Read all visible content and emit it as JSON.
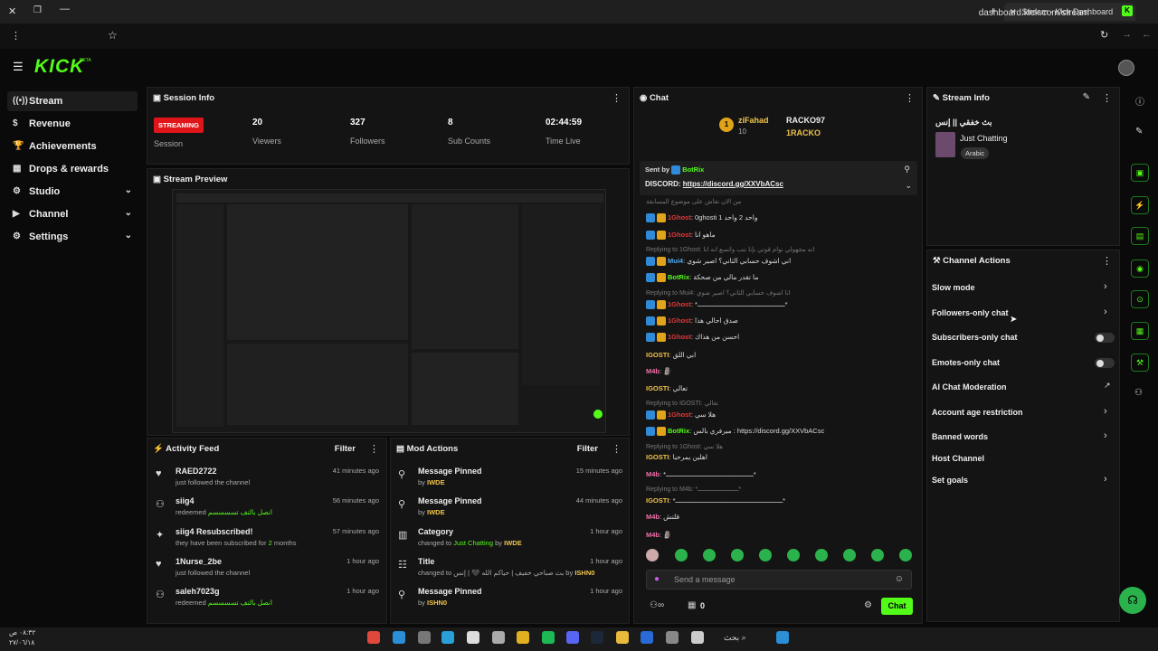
{
  "browser": {
    "tab_title": "Stream - Kick Dashboard",
    "url": "dashboard.kick.com/stream"
  },
  "brand": {
    "logo": "KICK",
    "beta": "BETA"
  },
  "sidebar": {
    "items": [
      {
        "label": "Stream",
        "icon": "stream-icon"
      },
      {
        "label": "Revenue",
        "icon": "dollar-icon"
      },
      {
        "label": "Achievements",
        "icon": "trophy-icon"
      },
      {
        "label": "Drops & rewards",
        "icon": "gift-icon"
      },
      {
        "label": "Studio",
        "icon": "gear-icon"
      },
      {
        "label": "Channel",
        "icon": "video-icon"
      },
      {
        "label": "Settings",
        "icon": "gear-icon"
      }
    ]
  },
  "session": {
    "title": "Session Info",
    "status": "STREAMING",
    "status_label": "Session",
    "viewers": "20",
    "viewers_label": "Viewers",
    "followers": "327",
    "followers_label": "Followers",
    "subs": "8",
    "subs_label": "Sub Counts",
    "time": "02:44:59",
    "time_label": "Time Live"
  },
  "preview": {
    "title": "Stream Preview"
  },
  "activity": {
    "title": "Activity Feed",
    "filter": "Filter",
    "items": [
      {
        "title": "RAED2722",
        "sub": "just followed the channel",
        "time": "41 minutes ago",
        "icon": "heart-icon"
      },
      {
        "title": "siig4",
        "sub": "redeemed",
        "sub2": "انصل بالتف تسسسسم",
        "time": "56 minutes ago",
        "icon": "redeem-icon"
      },
      {
        "title": "siig4 Resubscribed!",
        "sub": "they have been subscribed for",
        "sub2": "2",
        "sub3": "months",
        "time": "57 minutes ago",
        "icon": "star-icon"
      },
      {
        "title": "1Nurse_2be",
        "sub": "just followed the channel",
        "time": "1 hour ago",
        "icon": "heart-icon"
      },
      {
        "title": "saleh7023g",
        "sub": "redeemed",
        "sub2": "انصل بالتف تسسسسم",
        "time": "1 hour ago",
        "icon": "redeem-icon"
      }
    ]
  },
  "mod": {
    "title": "Mod Actions",
    "filter": "Filter",
    "items": [
      {
        "title": "Message Pinned",
        "sub": "by",
        "user": "IWDE",
        "time": "15 minutes ago",
        "icon": "pin-icon"
      },
      {
        "title": "Message Pinned",
        "sub": "by",
        "user": "IWDE",
        "time": "44 minutes ago",
        "icon": "pin-icon"
      },
      {
        "title": "Category",
        "sub": "changed to",
        "value": "Just Chatting",
        "sub2": "by",
        "user": "IWDE",
        "time": "1 hour ago",
        "icon": "category-icon"
      },
      {
        "title": "Title",
        "sub": "changed to",
        "value": "بث صباحي خفيف | حياكم الله 🖤 | إنس",
        "sub2": "by",
        "user": "ISHN0",
        "time": "1 hour ago",
        "icon": "title-icon"
      },
      {
        "title": "Message Pinned",
        "sub": "by",
        "user": "ISHN0",
        "time": "1 hour ago",
        "icon": "pin-icon"
      }
    ]
  },
  "chat": {
    "title": "Chat",
    "top1": {
      "name": "ziFahad",
      "count": "10",
      "rank": "1"
    },
    "top2": {
      "name": "RACKO97"
    },
    "top3": {
      "name": "1RACKO"
    },
    "pinned": {
      "sent_by": "Sent by",
      "user": "BotRix",
      "text_prefix": "DISCORD:",
      "link": "https://discord.gg/XXVbACsc"
    },
    "lines": [
      {
        "kind": "reply",
        "text": "من الان نقاش على موضوع المسابقة"
      },
      {
        "kind": "msg",
        "user": "1Ghost",
        "text": "0ghosti 1 واحد 2 واحد",
        "ucls": "u-red"
      },
      {
        "kind": "msg",
        "user": "1Ghost",
        "text": "ماهو انا",
        "ucls": "u-red"
      },
      {
        "kind": "reply",
        "text": "Replying to 1Ghost: انه مجهولي نوام قوتي بإنا نتب واتسع انه انا"
      },
      {
        "kind": "msg",
        "user": "Mui4",
        "text": "اني اشوف حسابي الثاني؟ اصير شوي",
        "ucls": "u-blue"
      },
      {
        "kind": "msg",
        "user": "BotRix",
        "text": "ما تقدر مالي من صحكة",
        "ucls": "u-green"
      },
      {
        "kind": "reply",
        "text": "Replying to Mui4: انا اشوف حسابي الثاني؟ اصير شوي"
      },
      {
        "kind": "msg",
        "user": "1Ghost",
        "text": "*ــــــــــــــــــــــــــــــــــــــــــــ*",
        "ucls": "u-red"
      },
      {
        "kind": "msg",
        "user": "1Ghost",
        "text": "صدق احالي هذا",
        "ucls": "u-red"
      },
      {
        "kind": "msg",
        "user": "1Ghost",
        "text": "احسن من هذاك",
        "ucls": "u-red"
      },
      {
        "kind": "msg",
        "user": "IGOSTI",
        "text": "ابي اللق",
        "ucls": "u-gold"
      },
      {
        "kind": "msg",
        "user": "M4b",
        "text": "🗿",
        "ucls": "u-pink"
      },
      {
        "kind": "msg",
        "user": "IGOSTI",
        "text": "تعالي",
        "ucls": "u-gold"
      },
      {
        "kind": "reply",
        "text": "Replying to IGOSTI: تعالي"
      },
      {
        "kind": "msg",
        "user": "1Ghost",
        "text": "هلا سي",
        "ucls": "u-red"
      },
      {
        "kind": "msg",
        "user": "BotRix",
        "text": "ميرفري بالس : https://discord.gg/XXVbACsc",
        "ucls": "u-green"
      },
      {
        "kind": "reply",
        "text": "Replying to 1Ghost: هلا سي"
      },
      {
        "kind": "msg",
        "user": "IGOSTI",
        "text": "اهلين يمرحبا",
        "ucls": "u-gold"
      },
      {
        "kind": "msg",
        "user": "M4b",
        "text": "*ــــــــــــــــــــــــــــــــــــــــــــ*",
        "ucls": "u-pink"
      },
      {
        "kind": "reply",
        "text": "Replying to M4b: *ــــــــــــــــــــــ*"
      },
      {
        "kind": "msg",
        "user": "IGOSTI",
        "text": "*ــــــــــــــــــــــــــــــــــــــــــــــــــــــ*",
        "ucls": "u-gold"
      },
      {
        "kind": "msg",
        "user": "M4b",
        "text": "قلتش",
        "ucls": "u-pink"
      },
      {
        "kind": "msg",
        "user": "M4b",
        "text": "🗿",
        "ucls": "u-pink"
      }
    ],
    "input_placeholder": "Send a message",
    "chat_button": "Chat",
    "viewers_count": "0"
  },
  "stream_info": {
    "title": "Stream Info",
    "stream_title": "بث خفقي || إنس",
    "category": "Just Chatting",
    "language": "Arabic"
  },
  "channel_actions": {
    "title": "Channel Actions",
    "items": [
      {
        "label": "Slow mode",
        "control": "chevron"
      },
      {
        "label": "Followers-only chat",
        "control": "chevron"
      },
      {
        "label": "Subscribers-only chat",
        "control": "toggle"
      },
      {
        "label": "Emotes-only chat",
        "control": "toggle"
      },
      {
        "label": "AI Chat Moderation",
        "control": "external"
      },
      {
        "label": "Account age restriction",
        "control": "chevron"
      },
      {
        "label": "Banned words",
        "control": "chevron"
      },
      {
        "label": "Host Channel",
        "control": "none"
      },
      {
        "label": "Set goals",
        "control": "chevron"
      }
    ]
  },
  "taskbar": {
    "clock_time": "٠٨:٣٢ ص",
    "clock_date": "٢٧/٠٦/١٨",
    "search": "بحث"
  },
  "colors": {
    "accent": "#53fc18",
    "live": "#e0151a",
    "panel": "#141414",
    "background": "#0a0a0a"
  }
}
